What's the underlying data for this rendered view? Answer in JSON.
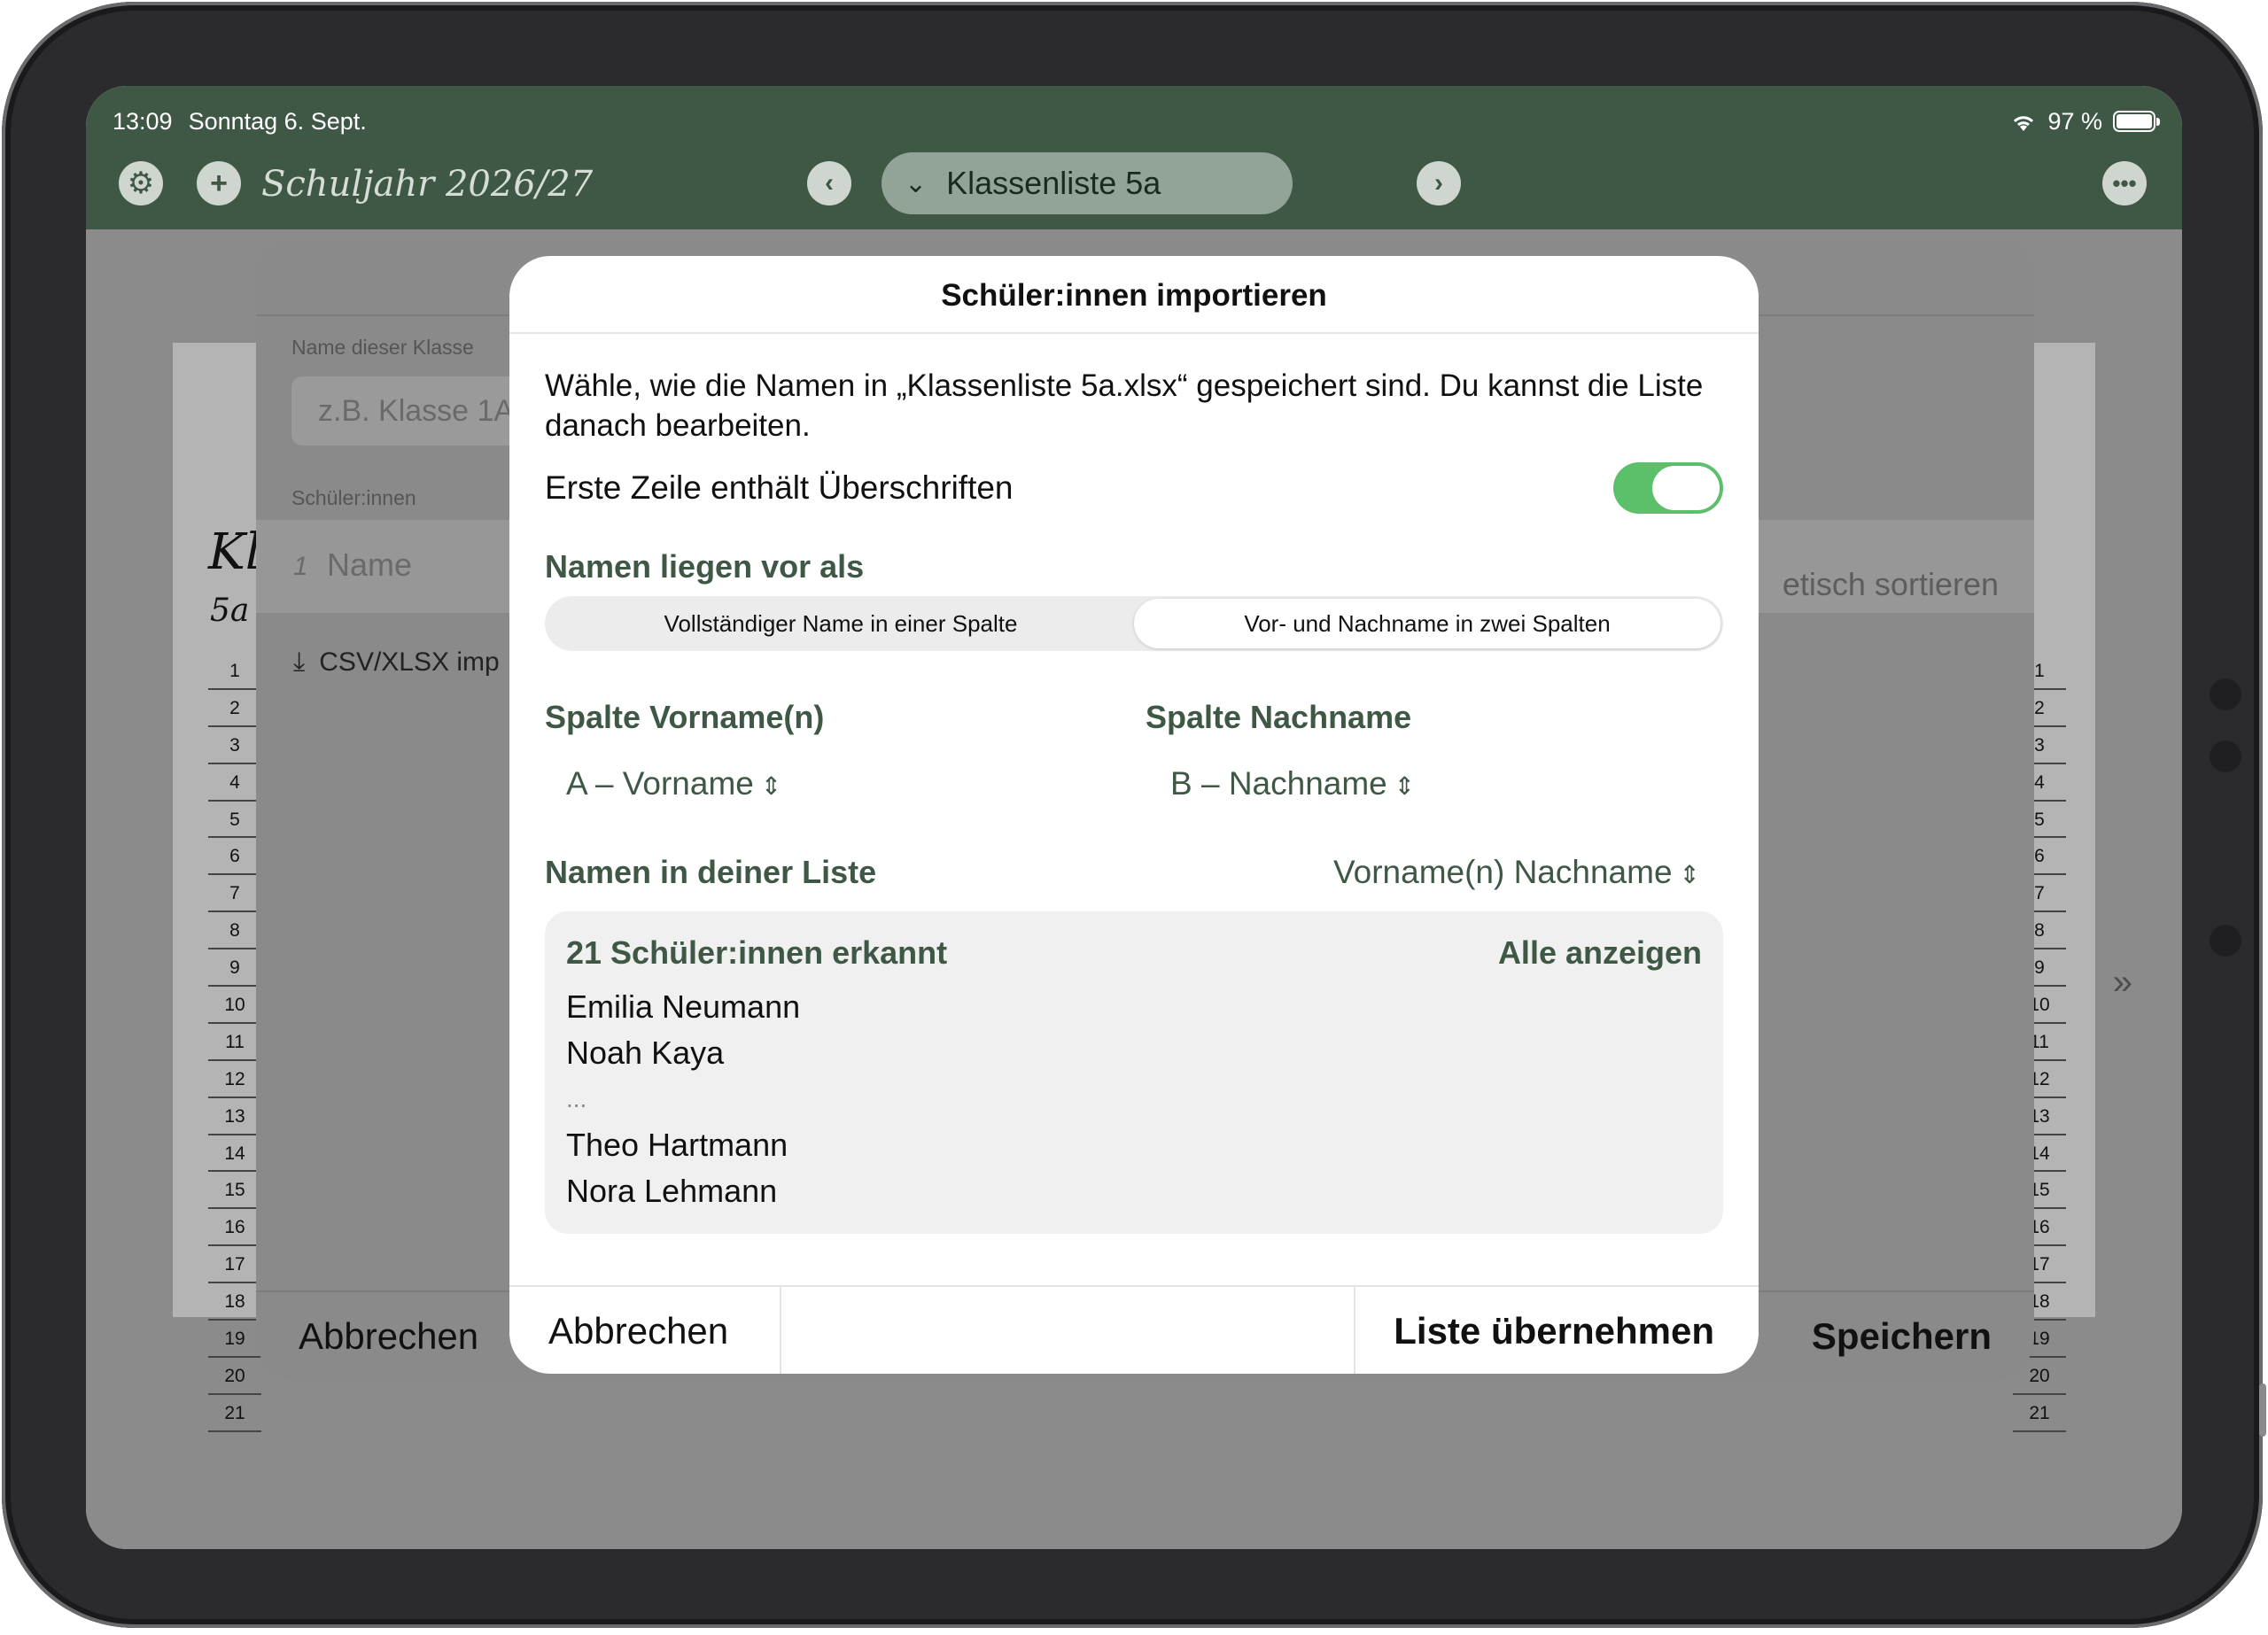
{
  "status": {
    "time": "13:09",
    "date": "Sonntag 6. Sept.",
    "battery": "97 %"
  },
  "toolbar": {
    "settings_icon": "gear-icon",
    "add_icon": "plus-icon",
    "year_title": "Schuljahr 2026/27",
    "prev_icon": "chevron-left-icon",
    "next_icon": "chevron-right-icon",
    "list_title": "Klassenliste 5a",
    "more_icon": "ellipsis-icon"
  },
  "background_sheet": {
    "class_name_label": "Name dieser Klasse",
    "class_name_placeholder": "z.B. Klasse 1A",
    "students_label": "Schüler:innen",
    "row_number": "1",
    "name_placeholder": "Name",
    "csv_button": "CSV/XLSX imp",
    "sort_label": "etisch sortieren",
    "cancel": "Abbrechen",
    "save": "Speichern",
    "paper_title": "Kl",
    "paper_subtitle": "5a",
    "row_numbers": [
      "1",
      "2",
      "3",
      "4",
      "5",
      "6",
      "7",
      "8",
      "9",
      "10",
      "11",
      "12",
      "13",
      "14",
      "15",
      "16",
      "17",
      "18",
      "19",
      "20",
      "21"
    ]
  },
  "dialog": {
    "title": "Schüler:innen importieren",
    "description": "Wähle, wie die Namen in „Klassenliste 5a.xlsx“ gespeichert sind. Du kannst die Liste danach bearbeiten.",
    "header_row_label": "Erste Zeile enthält Überschriften",
    "header_row_on": true,
    "format_heading": "Namen liegen vor als",
    "segments": [
      "Vollständiger Name in einer Spalte",
      "Vor- und Nachname in zwei Spalten"
    ],
    "selected_segment": 1,
    "first_name_heading": "Spalte Vorname(n)",
    "first_name_value": "A – Vorname",
    "last_name_heading": "Spalte Nachname",
    "last_name_value": "B – Nachname",
    "list_format_heading": "Namen in deiner Liste",
    "list_format_value": "Vorname(n) Nachname",
    "summary_count": "21 Schüler:innen erkannt",
    "show_all": "Alle anzeigen",
    "preview_names": [
      "Emilia Neumann",
      "Noah Kaya",
      "...",
      "Theo Hartmann",
      "Nora Lehmann"
    ],
    "cancel": "Abbrechen",
    "apply": "Liste übernehmen"
  },
  "colors": {
    "accent_green": "#3f5845",
    "toggle_on": "#5cbf6a"
  }
}
